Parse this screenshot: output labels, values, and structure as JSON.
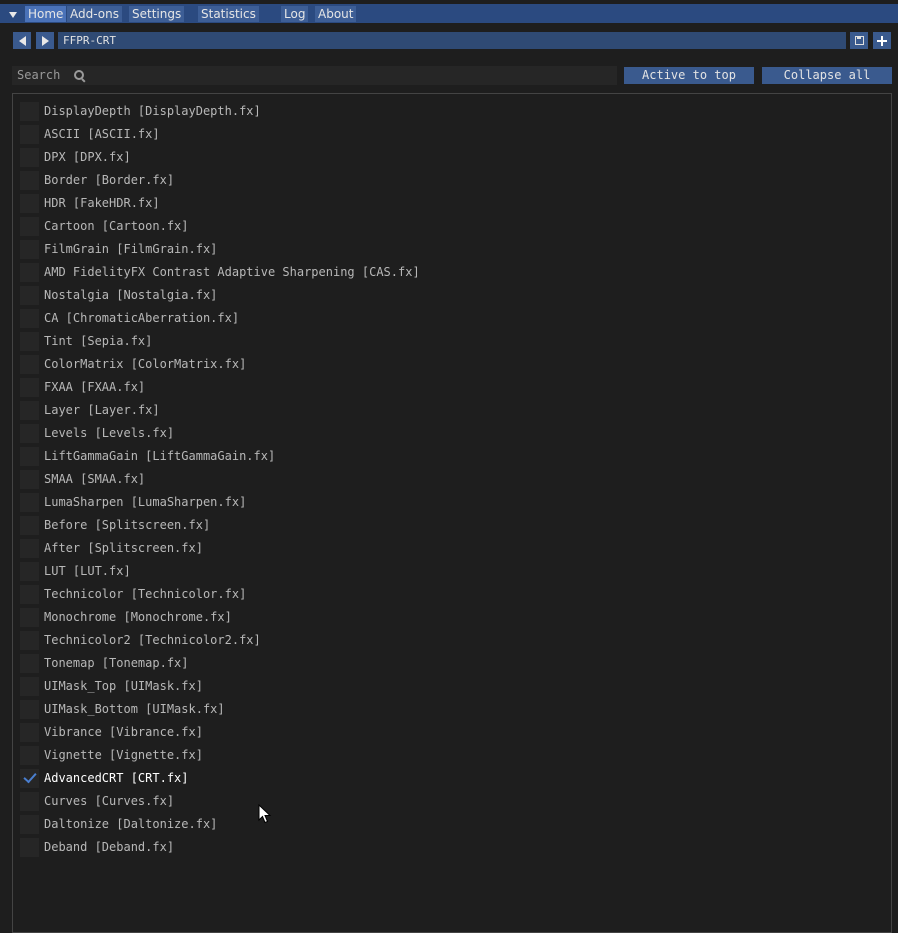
{
  "tabs": [
    {
      "label": "Home",
      "active": true
    },
    {
      "label": "Add-ons",
      "active": false
    },
    {
      "label": "Settings",
      "active": false
    },
    {
      "label": "Statistics",
      "active": false
    },
    {
      "label": "Log",
      "active": false
    },
    {
      "label": "About",
      "active": false
    }
  ],
  "toolbar": {
    "preset_name": "FFPR-CRT",
    "prev_icon": "arrow-left-icon",
    "next_icon": "arrow-right-icon",
    "save_icon": "save-icon",
    "add_icon": "plus-icon"
  },
  "search": {
    "label": "Search",
    "icon": "search-icon",
    "active_to_top_label": "Active to top",
    "collapse_all_label": "Collapse all"
  },
  "effects": [
    {
      "label": "DisplayDepth [DisplayDepth.fx]",
      "checked": false
    },
    {
      "label": "ASCII [ASCII.fx]",
      "checked": false
    },
    {
      "label": "DPX [DPX.fx]",
      "checked": false
    },
    {
      "label": "Border [Border.fx]",
      "checked": false
    },
    {
      "label": "HDR [FakeHDR.fx]",
      "checked": false
    },
    {
      "label": "Cartoon [Cartoon.fx]",
      "checked": false
    },
    {
      "label": "FilmGrain [FilmGrain.fx]",
      "checked": false
    },
    {
      "label": "AMD FidelityFX Contrast Adaptive Sharpening [CAS.fx]",
      "checked": false
    },
    {
      "label": "Nostalgia [Nostalgia.fx]",
      "checked": false
    },
    {
      "label": "CA [ChromaticAberration.fx]",
      "checked": false
    },
    {
      "label": "Tint [Sepia.fx]",
      "checked": false
    },
    {
      "label": "ColorMatrix [ColorMatrix.fx]",
      "checked": false
    },
    {
      "label": "FXAA [FXAA.fx]",
      "checked": false
    },
    {
      "label": "Layer [Layer.fx]",
      "checked": false
    },
    {
      "label": "Levels [Levels.fx]",
      "checked": false
    },
    {
      "label": "LiftGammaGain [LiftGammaGain.fx]",
      "checked": false
    },
    {
      "label": "SMAA [SMAA.fx]",
      "checked": false
    },
    {
      "label": "LumaSharpen [LumaSharpen.fx]",
      "checked": false
    },
    {
      "label": "Before [Splitscreen.fx]",
      "checked": false
    },
    {
      "label": "After [Splitscreen.fx]",
      "checked": false
    },
    {
      "label": "LUT [LUT.fx]",
      "checked": false
    },
    {
      "label": "Technicolor [Technicolor.fx]",
      "checked": false
    },
    {
      "label": "Monochrome [Monochrome.fx]",
      "checked": false
    },
    {
      "label": "Technicolor2 [Technicolor2.fx]",
      "checked": false
    },
    {
      "label": "Tonemap [Tonemap.fx]",
      "checked": false
    },
    {
      "label": "UIMask_Top [UIMask.fx]",
      "checked": false
    },
    {
      "label": "UIMask_Bottom [UIMask.fx]",
      "checked": false
    },
    {
      "label": "Vibrance [Vibrance.fx]",
      "checked": false
    },
    {
      "label": "Vignette [Vignette.fx]",
      "checked": false
    },
    {
      "label": "AdvancedCRT [CRT.fx]",
      "checked": true
    },
    {
      "label": "Curves [Curves.fx]",
      "checked": false
    },
    {
      "label": "Daltonize [Daltonize.fx]",
      "checked": false
    },
    {
      "label": "Deband [Deband.fx]",
      "checked": false
    }
  ],
  "colors": {
    "title_bar": "#2b4a80",
    "tab": "#3d5e96",
    "tab_active": "#4a72b8",
    "button": "#3a5a8e",
    "check_accent": "#4a7fd0",
    "background": "#1e1e1e"
  }
}
